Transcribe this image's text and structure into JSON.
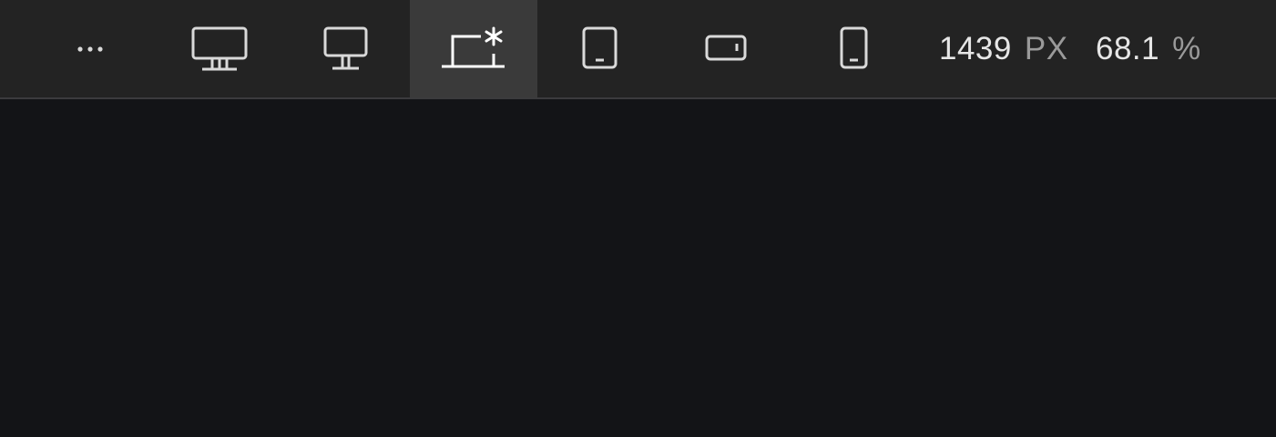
{
  "toolbar": {
    "buttons": [
      {
        "icon": "more-dots-icon",
        "active": false
      },
      {
        "icon": "large-desktop-icon",
        "active": false
      },
      {
        "icon": "desktop-icon",
        "active": false
      },
      {
        "icon": "laptop-custom-icon",
        "active": true
      },
      {
        "icon": "tablet-portrait-icon",
        "active": false
      },
      {
        "icon": "mobile-landscape-icon",
        "active": false
      },
      {
        "icon": "mobile-portrait-icon",
        "active": false
      }
    ],
    "width": {
      "value": "1439",
      "unit": "PX"
    },
    "zoom": {
      "value": "68.1",
      "unit": "%"
    }
  },
  "colors": {
    "toolbar_bg": "#232323",
    "active_bg": "#3a3a3a",
    "canvas_bg": "#131417",
    "icon": "#d9d9d9",
    "value_text": "#e6e6e6",
    "unit_text": "#9a9a9a"
  }
}
